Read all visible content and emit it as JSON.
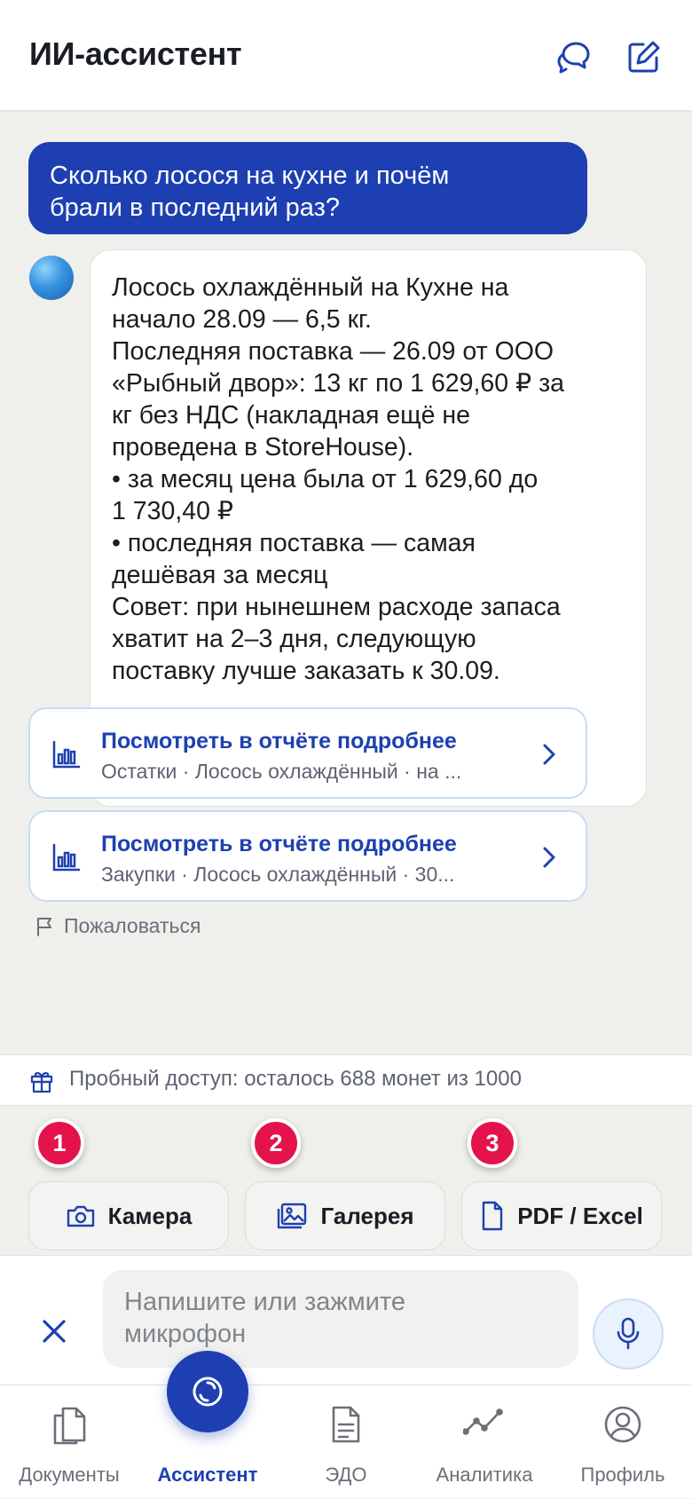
{
  "header": {
    "title": "ИИ-ассистент"
  },
  "chat": {
    "user_message_lines": [
      "Сколько лосося на кухне и почём",
      "брали в последний раз?"
    ],
    "bot_message_lines": [
      "Лосось охлаждённый на Кухне на",
      "начало 28.09 — 6,5 кг.",
      "Последняя поставка — 26.09 от ООО",
      "«Рыбный двор»: 13 кг по 1 629,60 ₽ за",
      "кг без НДС (накладная ещё не",
      "проведена в StoreHouse).",
      "• за месяц цена была от 1 629,60 до",
      "1 730,40 ₽",
      "• последняя поставка — самая",
      "дешёвая за месяц",
      "Совет: при нынешнем расходе запаса",
      "хватит на 2–3 дня, следующую",
      "поставку лучше заказать к 30.09."
    ],
    "links": [
      {
        "title": "Посмотреть в отчёте подробнее",
        "subtitle": "Остатки · Лосось охлаждённый · на ..."
      },
      {
        "title": "Посмотреть в отчёте подробнее",
        "subtitle": "Закупки · Лосось охлаждённый · 30..."
      }
    ],
    "report_label": "Пожаловаться"
  },
  "trial": {
    "text": "Пробный доступ: осталось 688 монет из 1000"
  },
  "attachments": [
    {
      "badge": "1",
      "label": "Камера",
      "icon": "camera-icon"
    },
    {
      "badge": "2",
      "label": "Галерея",
      "icon": "gallery-icon"
    },
    {
      "badge": "3",
      "label": "PDF / Excel",
      "icon": "file-icon"
    }
  ],
  "composer": {
    "placeholder_lines": [
      "Напишите или зажмите",
      "микрофон"
    ]
  },
  "tabs": [
    {
      "label": "Документы",
      "icon": "documents-icon"
    },
    {
      "label": "Ассистент",
      "icon": "assistant-icon",
      "active": true
    },
    {
      "label": "ЭДО",
      "icon": "edo-icon"
    },
    {
      "label": "Аналитика",
      "icon": "analytics-icon"
    },
    {
      "label": "Профиль",
      "icon": "profile-icon"
    }
  ],
  "colors": {
    "accent": "#1d3fb1",
    "badge": "#e4134b",
    "link": "#1e40b0"
  }
}
